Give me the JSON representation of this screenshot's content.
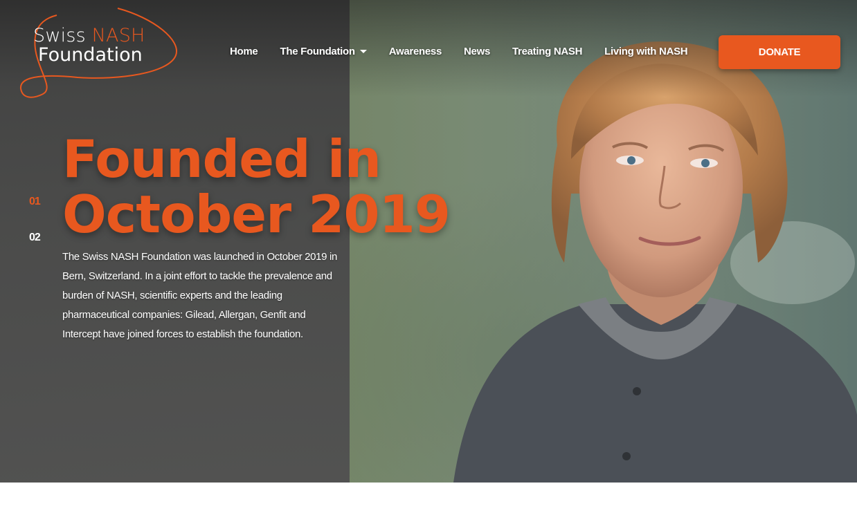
{
  "brand": {
    "logo_word1": "Swiss",
    "logo_word2": "NASH",
    "logo_line2": "Foundation",
    "accent_color": "#e8581f"
  },
  "nav": {
    "items": [
      {
        "label": "Home"
      },
      {
        "label": "The Foundation",
        "has_dropdown": true
      },
      {
        "label": "Awareness"
      },
      {
        "label": "News"
      },
      {
        "label": "Treating NASH"
      },
      {
        "label": "Living with NASH"
      }
    ],
    "donate_label": "DONATE"
  },
  "hero": {
    "headline_line1": "Founded in",
    "headline_line2": "October 2019",
    "slides": [
      "01",
      "02"
    ],
    "active_slide": "01",
    "body": "The Swiss NASH Foundation was launched in October 2019 in Bern, Switzerland. In a joint effort to tackle the prevalence and burden of NASH, scientific experts and the leading pharmaceutical companies: Gilead, Allergan, Genfit and Intercept have joined forces to establish the foundation."
  }
}
